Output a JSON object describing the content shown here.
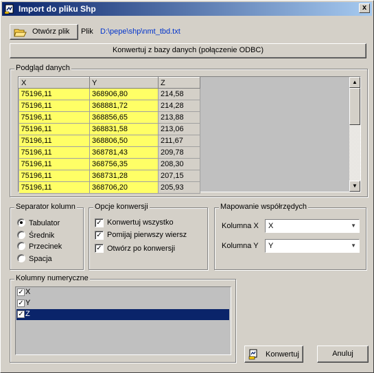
{
  "window": {
    "title": "Import do pliku Shp",
    "close_glyph": "x"
  },
  "file": {
    "open_button_label": "Otwórz plik",
    "file_label": "Plik",
    "file_path": "D:\\pepe\\shp\\nmt_tbd.txt",
    "convert_db_button_label": "Konwertuj z bazy danych (połączenie ODBC)"
  },
  "preview": {
    "group_label": "Podgląd danych",
    "columns": [
      "X",
      "Y",
      "Z"
    ],
    "rows": [
      [
        "75196,11",
        "368906,80",
        "214,58"
      ],
      [
        "75196,11",
        "368881,72",
        "214,28"
      ],
      [
        "75196,11",
        "368856,65",
        "213,88"
      ],
      [
        "75196,11",
        "368831,58",
        "213,06"
      ],
      [
        "75196,11",
        "368806,50",
        "211,67"
      ],
      [
        "75196,11",
        "368781,43",
        "209,78"
      ],
      [
        "75196,11",
        "368756,35",
        "208,30"
      ],
      [
        "75196,11",
        "368731,28",
        "207,15"
      ],
      [
        "75196,11",
        "368706,20",
        "205,93"
      ]
    ],
    "scroll_position": 0.0
  },
  "separator": {
    "group_label": "Separator kolumn",
    "options": [
      "Tabulator",
      "Średnik",
      "Przecinek",
      "Spacja"
    ],
    "selected": "Tabulator"
  },
  "conversion_options": {
    "group_label": "Opcje konwersji",
    "items": [
      {
        "label": "Konwertuj wszystko",
        "checked": true
      },
      {
        "label": "Pomijaj pierwszy wiersz",
        "checked": true
      },
      {
        "label": "Otwórz po konwersji",
        "checked": true
      }
    ]
  },
  "mapping": {
    "group_label": "Mapowanie współrzędych",
    "col_x_label": "Kolumna X",
    "col_x_value": "X",
    "col_y_label": "Kolumna Y",
    "col_y_value": "Y"
  },
  "numeric_columns": {
    "group_label": "Kolumny numeryczne",
    "items": [
      {
        "label": "X",
        "checked": true,
        "selected": false
      },
      {
        "label": "Y",
        "checked": true,
        "selected": false
      },
      {
        "label": "Z",
        "checked": true,
        "selected": true
      }
    ]
  },
  "actions": {
    "convert_label": "Konwertuj",
    "cancel_label": "Anuluj"
  },
  "colors": {
    "highlight_cell": "#ffff66",
    "selection": "#0a246a",
    "link_text": "#0033cc"
  }
}
